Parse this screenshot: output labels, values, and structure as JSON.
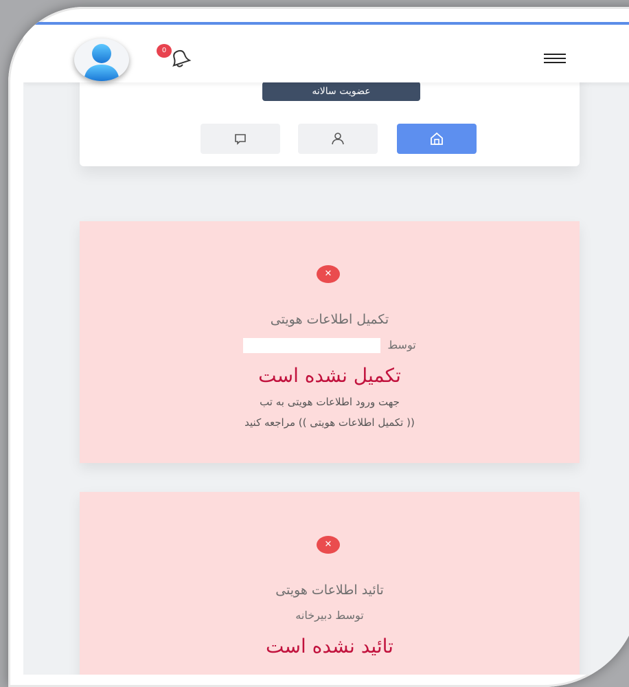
{
  "header": {
    "notification_count": "0",
    "icons": [
      "avatar-icon",
      "bell-icon",
      "menu-icon"
    ],
    "accent_color": "#5b8de8"
  },
  "profile": {
    "membership_label": "عضویت سالانه",
    "tabs": [
      {
        "icon": "home-icon",
        "active": true
      },
      {
        "icon": "user-icon",
        "active": false
      },
      {
        "icon": "message-icon",
        "active": false
      }
    ]
  },
  "cards": [
    {
      "title": "تکمیل اطلاعات هویتی",
      "by": "توسط",
      "status": "تکمیل نشده است",
      "note_line1": "جهت ورود اطلاعات هویتی به تب",
      "note_line2": "(( تکمیل اطلاعات هویتی )) مراجعه کنید"
    },
    {
      "title": "تائید اطلاعات هویتی",
      "by": "توسط دبیرخانه",
      "status": "تائید نشده است"
    }
  ],
  "colors": {
    "card_bg": "#fddcdc",
    "status_text": "#c1123d",
    "error_icon": "#ea4c4e",
    "active_tab": "#5d8fef",
    "badge": "#e8434f"
  }
}
